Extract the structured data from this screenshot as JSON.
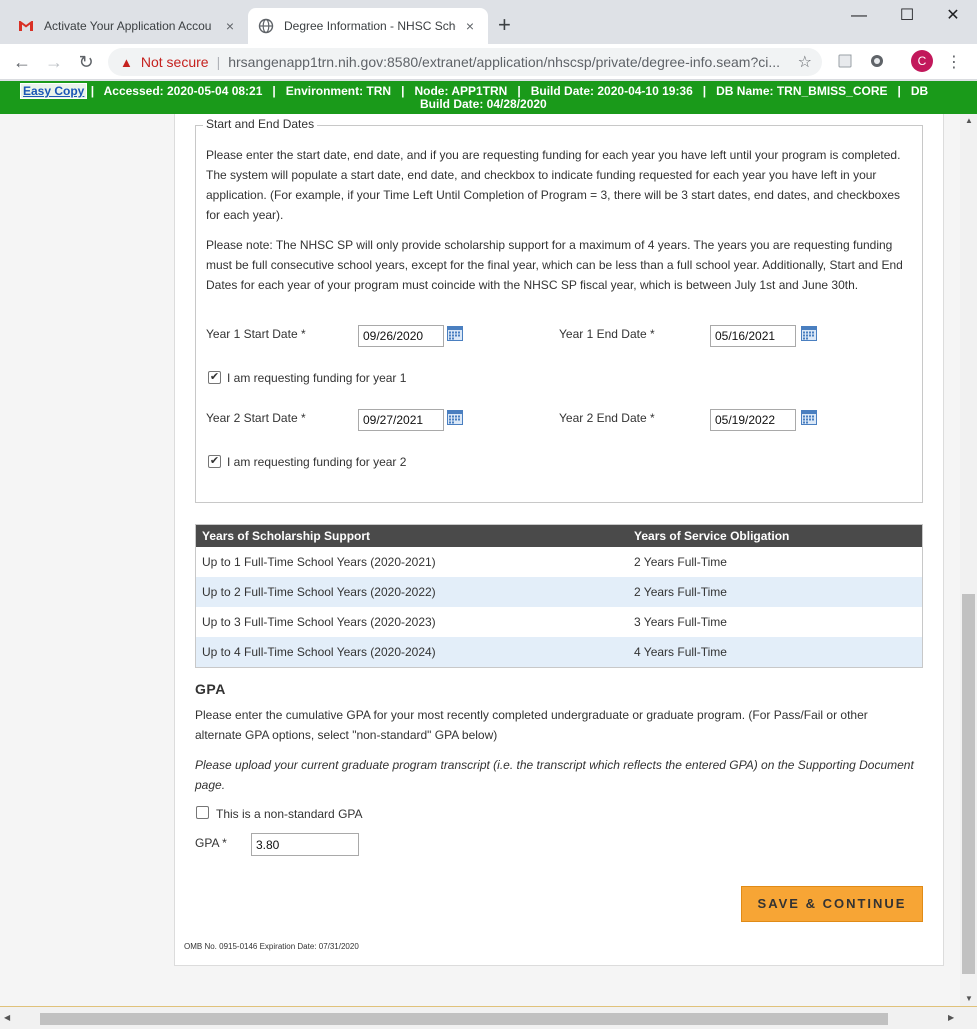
{
  "browser": {
    "tabs": [
      {
        "title": "Activate Your Application Accou",
        "favicon": "gmail-icon",
        "close": "×"
      },
      {
        "title": "Degree Information - NHSC Scho",
        "favicon": "globe-icon",
        "close": "×"
      }
    ],
    "new_tab": "+",
    "window_controls": {
      "minimize": "—",
      "maximize": "☐",
      "close": "✕"
    },
    "security_label": "Not secure",
    "url": "hrsangenapp1trn.nih.gov:8580/extranet/application/nhscsp/private/degree-info.seam?ci...",
    "profile_initial": "C"
  },
  "envbar": {
    "easy_copy": "Easy Copy",
    "line1": "|   Accessed: 2020-05-04 08:21   |   Environment: TRN   |   Node: APP1TRN   |   Build Date: 2020-04-10 19:36   |   DB Name: TRN_BMISS_CORE   |   DB",
    "line2": "Build Date: 04/28/2020"
  },
  "dates_section": {
    "legend": "Start and End Dates",
    "para1": "Please enter the start date, end date, and if you are requesting funding for each year you have left until your program is completed. The system will populate a start date, end date, and checkbox to indicate funding requested for each year you have left in your application. (For example, if your Time Left Until Completion of Program = 3, there will be 3 start dates, end dates, and checkboxes for each year).",
    "para2": "Please note: The NHSC SP will only provide scholarship support for a maximum of 4 years. The years you are requesting funding must be full consecutive school years, except for the final year, which can be less than a full school year. Additionally, Start and End Dates for each year of your program must coincide with the NHSC SP fiscal year, which is between July 1st and June 30th.",
    "years": [
      {
        "start_label": "Year 1 Start Date *",
        "start_value": "09/26/2020",
        "end_label": "Year 1 End Date *",
        "end_value": "05/16/2021",
        "funding_label": "I am requesting funding for year 1",
        "funding_checked": true
      },
      {
        "start_label": "Year 2 Start Date *",
        "start_value": "09/27/2021",
        "end_label": "Year 2 End Date *",
        "end_value": "05/19/2022",
        "funding_label": "I am requesting funding for year 2",
        "funding_checked": true
      }
    ]
  },
  "obligation_table": {
    "headers": [
      "Years of Scholarship Support",
      "Years of Service Obligation"
    ],
    "rows": [
      [
        "Up to 1 Full-Time School Years (2020-2021)",
        "2 Years Full-Time"
      ],
      [
        "Up to 2 Full-Time School Years (2020-2022)",
        "2 Years Full-Time"
      ],
      [
        "Up to 3 Full-Time School Years (2020-2023)",
        "3 Years Full-Time"
      ],
      [
        "Up to 4 Full-Time School Years (2020-2024)",
        "4 Years Full-Time"
      ]
    ]
  },
  "gpa": {
    "heading": "GPA",
    "instructions": "Please enter the cumulative GPA for your most recently completed undergraduate or graduate program. (For Pass/Fail or other alternate GPA options, select \"non-standard\" GPA below)",
    "upload_note": "Please upload your current graduate program transcript (i.e. the transcript which reflects the entered GPA) on the Supporting Document page.",
    "nonstandard_label": "This is a non-standard GPA",
    "nonstandard_checked": false,
    "field_label": "GPA *",
    "value": "3.80"
  },
  "actions": {
    "save_continue": "SAVE & CONTINUE"
  },
  "footer": {
    "omb": "OMB No. 0915-0146 Expiration Date: 07/31/2020"
  }
}
